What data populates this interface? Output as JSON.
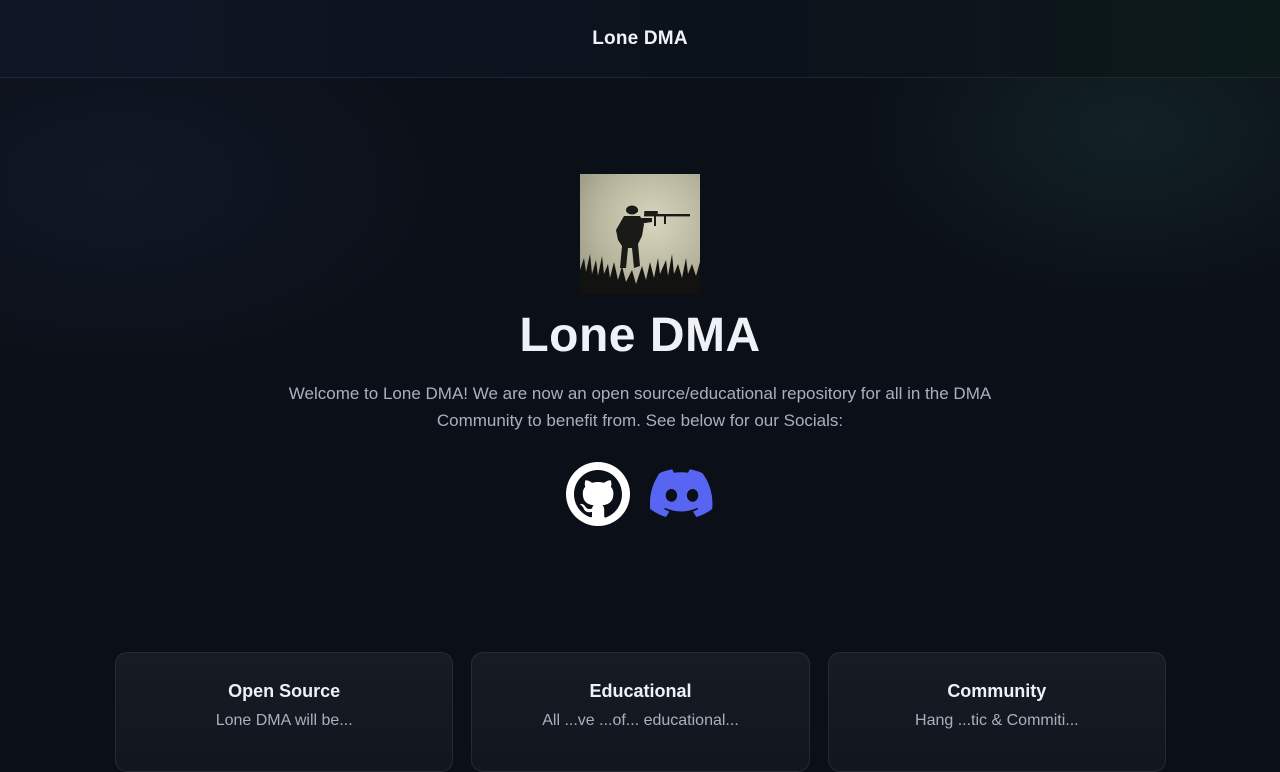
{
  "header": {
    "title": "Lone DMA"
  },
  "hero": {
    "title": "Lone DMA",
    "description": "Welcome to Lone DMA! We are now an open source/educational repository for all in the DMA Community to benefit from. See below for our Socials:"
  },
  "socials": [
    {
      "icon": "github-icon",
      "label": "GitHub"
    },
    {
      "icon": "discord-icon",
      "label": "Discord",
      "color": "#5865F2"
    }
  ],
  "cards": [
    {
      "title": "Open Source",
      "text": "Lone DMA will be..."
    },
    {
      "title": "Educational",
      "text": "All ...ve ...of... educational..."
    },
    {
      "title": "Community",
      "text": "Hang ...tic & Commiti..."
    }
  ]
}
